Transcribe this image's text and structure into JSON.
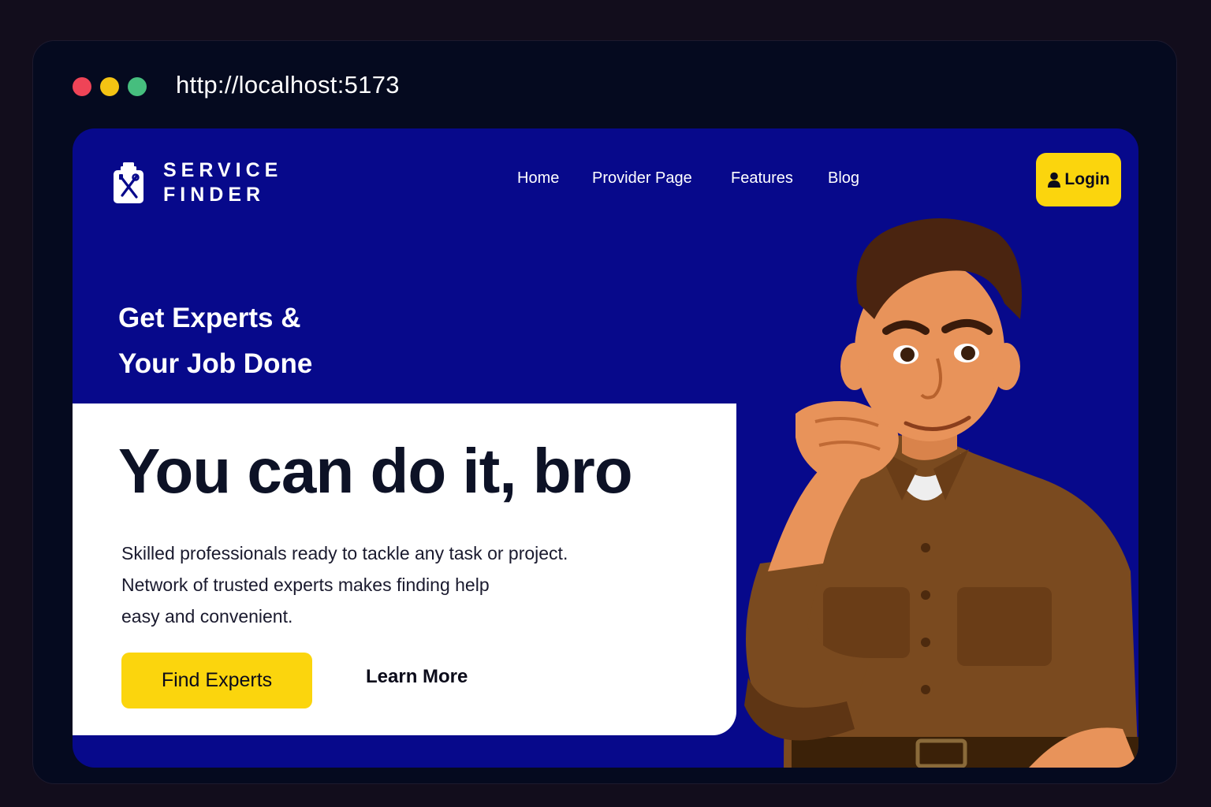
{
  "browser": {
    "url": "http://localhost:5173",
    "dots": [
      "#ef4457",
      "#f4c313",
      "#46be7e"
    ]
  },
  "brand": {
    "line1": "SERVICE",
    "line2": "FINDER"
  },
  "nav": {
    "items": [
      "Home",
      "Provider Page",
      "Features",
      "Blog"
    ]
  },
  "login": {
    "label": "Login"
  },
  "hero": {
    "tagline_line1": "Get Experts &",
    "tagline_line2": "Your Job Done",
    "headline": "You can do it, bro",
    "description_lines": [
      "Skilled professionals ready to tackle any task or project.",
      "Network of trusted experts makes finding help",
      "easy and convenient."
    ],
    "primary_button": "Find Experts",
    "secondary_button": "Learn More"
  },
  "colors": {
    "background_blue": "#07098b",
    "accent_yellow": "#fbd50d",
    "card_white": "#ffffff"
  }
}
